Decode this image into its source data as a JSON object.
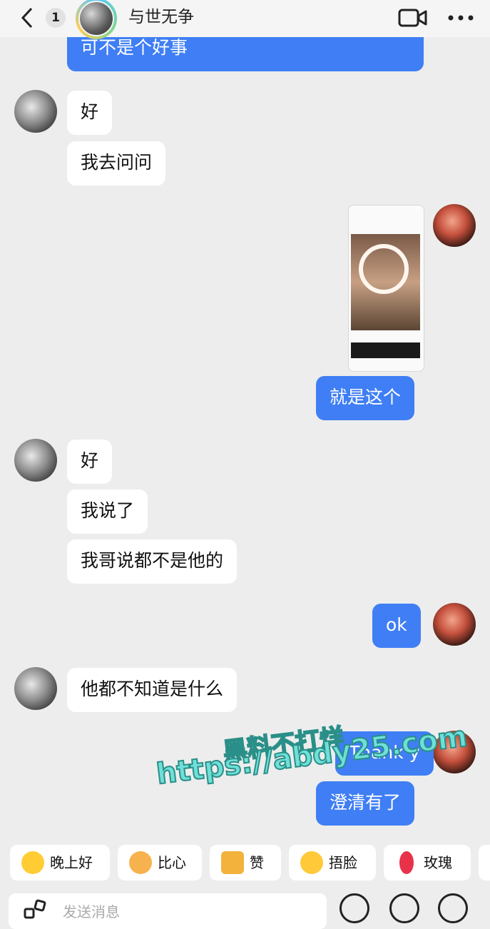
{
  "header": {
    "unread_count": "1",
    "contact_name": "与世无争"
  },
  "messages": {
    "top_partial": "可不是个好事",
    "m1": "好",
    "m2": "我去问问",
    "m3": "就是这个",
    "m4": "好",
    "m5": "我说了",
    "m6": "我哥说都不是他的",
    "m7": "ok",
    "m8": "他都不知道是什么",
    "m9": "Thank y",
    "m10": "澄清有了"
  },
  "watermark": {
    "line1": "黑料不打烊",
    "line2": "https://abdy25.com"
  },
  "quick_replies": [
    "晚上好",
    "比心",
    "赞",
    "捂脸",
    "玫瑰"
  ],
  "input": {
    "placeholder": "发送消息"
  },
  "colors": {
    "bubble_out": "#3f7ef4",
    "bubble_in": "#ffffff",
    "background": "#ededed"
  }
}
